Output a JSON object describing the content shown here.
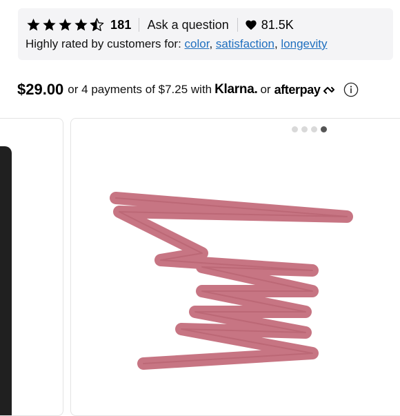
{
  "rating": {
    "stars_value": 4.5,
    "stars_max": 5,
    "review_count": "181",
    "ask_label": "Ask a question",
    "loves_count": "81.5K"
  },
  "highlights": {
    "prefix": "Highly rated by customers for: ",
    "tags": [
      "color",
      "satisfaction",
      "longevity"
    ],
    "separator": ", "
  },
  "price": {
    "amount": "$29.00",
    "installment_text": "or 4 payments of $7.25 with",
    "klarna": "Klarna.",
    "or_text": "or",
    "afterpay": "afterpay"
  },
  "carousel": {
    "dot_count": 4,
    "active_index": 3
  },
  "colors": {
    "link": "#1f6fbf",
    "swatch": "#c46e7c",
    "review_bg": "#f4f4f6"
  },
  "icons": {
    "star": "star-icon",
    "heart": "heart-icon",
    "afterpay": "afterpay-loop-icon",
    "info": "info-icon"
  }
}
